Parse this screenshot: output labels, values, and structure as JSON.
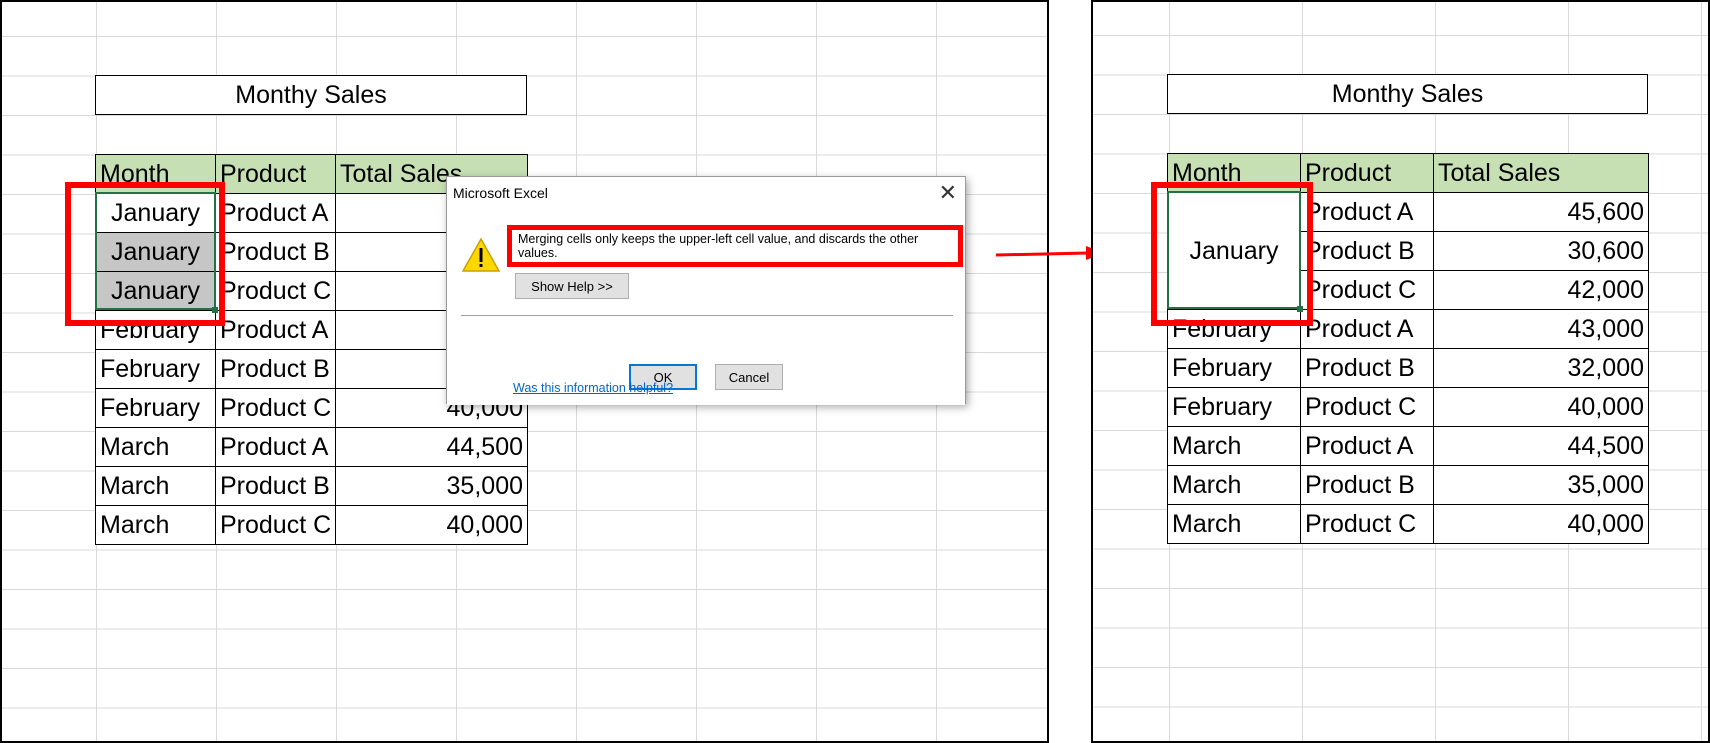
{
  "left": {
    "title": "Monthy Sales",
    "headers": [
      "Month",
      "Product",
      "Total Sales"
    ],
    "rows": [
      [
        "January",
        "Product A",
        ""
      ],
      [
        "January",
        "Product B",
        ""
      ],
      [
        "January",
        "Product C",
        ""
      ],
      [
        "February",
        "Product A",
        ""
      ],
      [
        "February",
        "Product B",
        ""
      ],
      [
        "February",
        "Product C",
        "40,000"
      ],
      [
        "March",
        "Product A",
        "44,500"
      ],
      [
        "March",
        "Product B",
        "35,000"
      ],
      [
        "March",
        "Product C",
        "40,000"
      ]
    ]
  },
  "dialog": {
    "title": "Microsoft Excel",
    "close_glyph": "✕",
    "message": "Merging cells only keeps the upper-left cell value, and discards the other values.",
    "show_help": "Show Help >>",
    "ok": "OK",
    "cancel": "Cancel",
    "help_link": "Was this information helpful?"
  },
  "right": {
    "title": "Monthy Sales",
    "headers": [
      "Month",
      "Product",
      "Total Sales"
    ],
    "merged_month": "January",
    "rows": [
      [
        "",
        "Product A",
        "45,600"
      ],
      [
        "",
        "Product B",
        "30,600"
      ],
      [
        "",
        "Product C",
        "42,000"
      ],
      [
        "February",
        "Product A",
        "43,000"
      ],
      [
        "February",
        "Product B",
        "32,000"
      ],
      [
        "February",
        "Product C",
        "40,000"
      ],
      [
        "March",
        "Product A",
        "44,500"
      ],
      [
        "March",
        "Product B",
        "35,000"
      ],
      [
        "March",
        "Product C",
        "40,000"
      ]
    ]
  },
  "colors": {
    "header_fill": "#c6e0b4",
    "highlight": "#ff0000",
    "selection": "#217346",
    "selected_cell": "#c6c6c6"
  },
  "icons": [
    "warning-icon",
    "close-icon",
    "arrow-right-icon"
  ]
}
